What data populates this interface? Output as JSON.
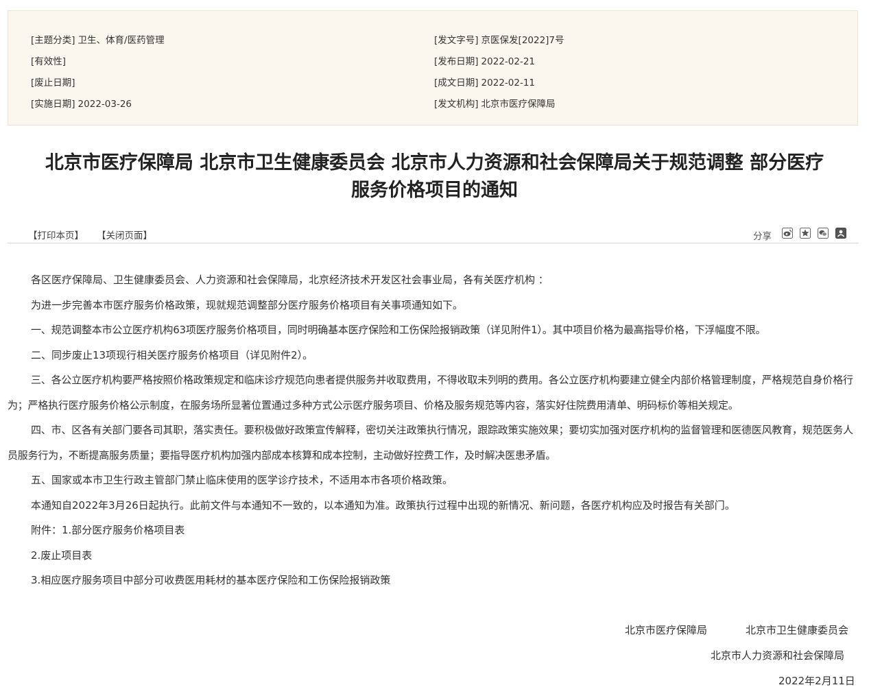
{
  "meta": {
    "left": [
      {
        "label": "[主题分类]",
        "value": "卫生、体育/医药管理"
      },
      {
        "label": "[有效性]",
        "value": ""
      },
      {
        "label": "[废止日期]",
        "value": ""
      },
      {
        "label": "[实施日期]",
        "value": "2022-03-26"
      }
    ],
    "right": [
      {
        "label": "[发文字号]",
        "value": "京医保发[2022]7号"
      },
      {
        "label": "[发布日期]",
        "value": "2022-02-21"
      },
      {
        "label": "[成文日期]",
        "value": "2022-02-11"
      },
      {
        "label": "[发文机构]",
        "value": "北京市医疗保障局"
      }
    ]
  },
  "title": {
    "line1": "北京市医疗保障局 北京市卫生健康委员会 北京市人力资源和社会保障局关于规范调整 部分医疗",
    "line2": "服务价格项目的通知"
  },
  "toolbar": {
    "print": "【打印本页】",
    "close": "【关闭页面】",
    "share": "分享"
  },
  "share_icons": [
    "weibo-icon",
    "qzone-icon",
    "wechat-icon",
    "renren-icon"
  ],
  "body": {
    "p1": "各区医疗保障局、卫生健康委员会、人力资源和社会保障局，北京经济技术开发区社会事业局，各有关医疗机构 ：",
    "p2": "为进一步完善本市医疗服务价格政策，现就规范调整部分医疗服务价格项目有关事项通知如下。",
    "p3": "一、规范调整本市公立医疗机构63项医疗服务价格项目，同时明确基本医疗保险和工伤保险报销政策（详见附件1）。其中项目价格为最高指导价格，下浮幅度不限。",
    "p4": "二、同步废止13项现行相关医疗服务价格项目（详见附件2）。",
    "p5": "三、各公立医疗机构要严格按照价格政策规定和临床诊疗规范向患者提供服务并收取费用，不得收取未列明的费用。各公立医疗机构要建立健全内部价格管理制度，严格规范自身价格行为；严格执行医疗服务价格公示制度，在服务场所显著位置通过多种方式公示医疗服务项目、价格及服务规范等内容，落实好住院费用清单、明码标价等相关规定。",
    "p6": "四、市、区各有关部门要各司其职，落实责任。要积极做好政策宣传解释，密切关注政策执行情况，跟踪政策实施效果；要切实加强对医疗机构的监督管理和医德医风教育，规范医务人员服务行为，不断提高服务质量；要指导医疗机构加强内部成本核算和成本控制，主动做好控费工作，及时解决医患矛盾。",
    "p7": "五、国家或本市卫生行政主管部门禁止临床使用的医学诊疗技术，不适用本市各项价格政策。",
    "p8": "本通知自2022年3月26日起执行。此前文件与本通知不一致的，以本通知为准。政策执行过程中出现的新情况、新问题，各医疗机构应及时报告有关部门。",
    "p9": "附件：1.部分医疗服务价格项目表",
    "p10": "2.废止项目表",
    "p11": "3.相应医疗服务项目中部分可收费医用耗材的基本医疗保险和工伤保险报销政策"
  },
  "signature": {
    "org1": "北京市医疗保障局",
    "org2": "北京市卫生健康委员会",
    "org3": "北京市人力资源和社会保障局",
    "date": "2022年2月11日"
  }
}
